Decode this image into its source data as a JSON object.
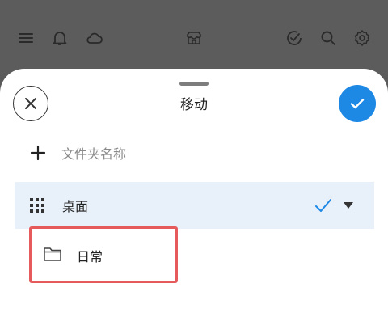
{
  "topbar": {
    "icons": [
      "menu-icon",
      "bell-icon",
      "cloud-icon",
      "store-icon",
      "check-circle-icon",
      "search-icon",
      "settings-icon"
    ]
  },
  "sheet": {
    "title": "移动",
    "new_folder_placeholder": "文件夹名称",
    "folders": [
      {
        "label": "桌面",
        "selected": true,
        "expanded": false
      },
      {
        "label": "日常",
        "selected": false,
        "highlighted": true
      }
    ]
  },
  "colors": {
    "accent": "#1e88e5",
    "selected_row_bg": "#e8f0f9",
    "highlight_border": "#e55b5b",
    "overlay": "#5c5c5c"
  }
}
